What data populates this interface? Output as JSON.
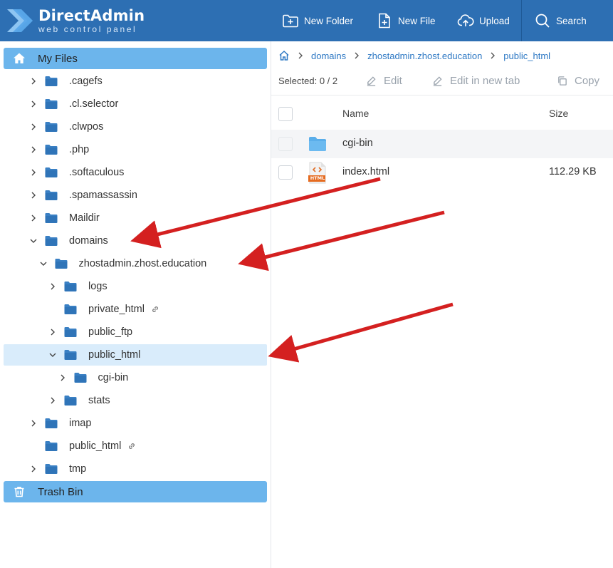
{
  "app": {
    "title": "DirectAdmin",
    "subtitle": "web control panel"
  },
  "header": {
    "new_folder": "New Folder",
    "new_file": "New File",
    "upload": "Upload",
    "search": "Search"
  },
  "sidebar": {
    "my_files": "My Files",
    "trash": "Trash Bin",
    "items": [
      {
        "label": ".cagefs"
      },
      {
        "label": ".cl.selector"
      },
      {
        "label": ".clwpos"
      },
      {
        "label": ".php"
      },
      {
        "label": ".softaculous"
      },
      {
        "label": ".spamassassin"
      },
      {
        "label": "Maildir"
      },
      {
        "label": "domains"
      },
      {
        "label": "zhostadmin.zhost.education"
      },
      {
        "label": "logs"
      },
      {
        "label": "private_html"
      },
      {
        "label": "public_ftp"
      },
      {
        "label": "public_html"
      },
      {
        "label": "cgi-bin"
      },
      {
        "label": "stats"
      },
      {
        "label": "imap"
      },
      {
        "label": "public_html"
      },
      {
        "label": "tmp"
      }
    ]
  },
  "breadcrumb": [
    "domains",
    "zhostadmin.zhost.education",
    "public_html"
  ],
  "toolbar": {
    "selected": "Selected: 0 / 2",
    "edit": "Edit",
    "edit_new_tab": "Edit in new tab",
    "copy": "Copy"
  },
  "table": {
    "col_name": "Name",
    "col_size": "Size",
    "rows": [
      {
        "name": "cgi-bin",
        "size": "",
        "icon": "folder-icon"
      },
      {
        "name": "index.html",
        "size": "112.29 KB",
        "icon": "html-file-icon",
        "badge": "HTML"
      }
    ]
  },
  "colors": {
    "header_bg": "#2d6fb3",
    "sidebar_active": "#6cb5ec",
    "tree_selected": "#d9ecfb",
    "folder": "#3a80c4",
    "annotation_arrow": "#d42020"
  }
}
